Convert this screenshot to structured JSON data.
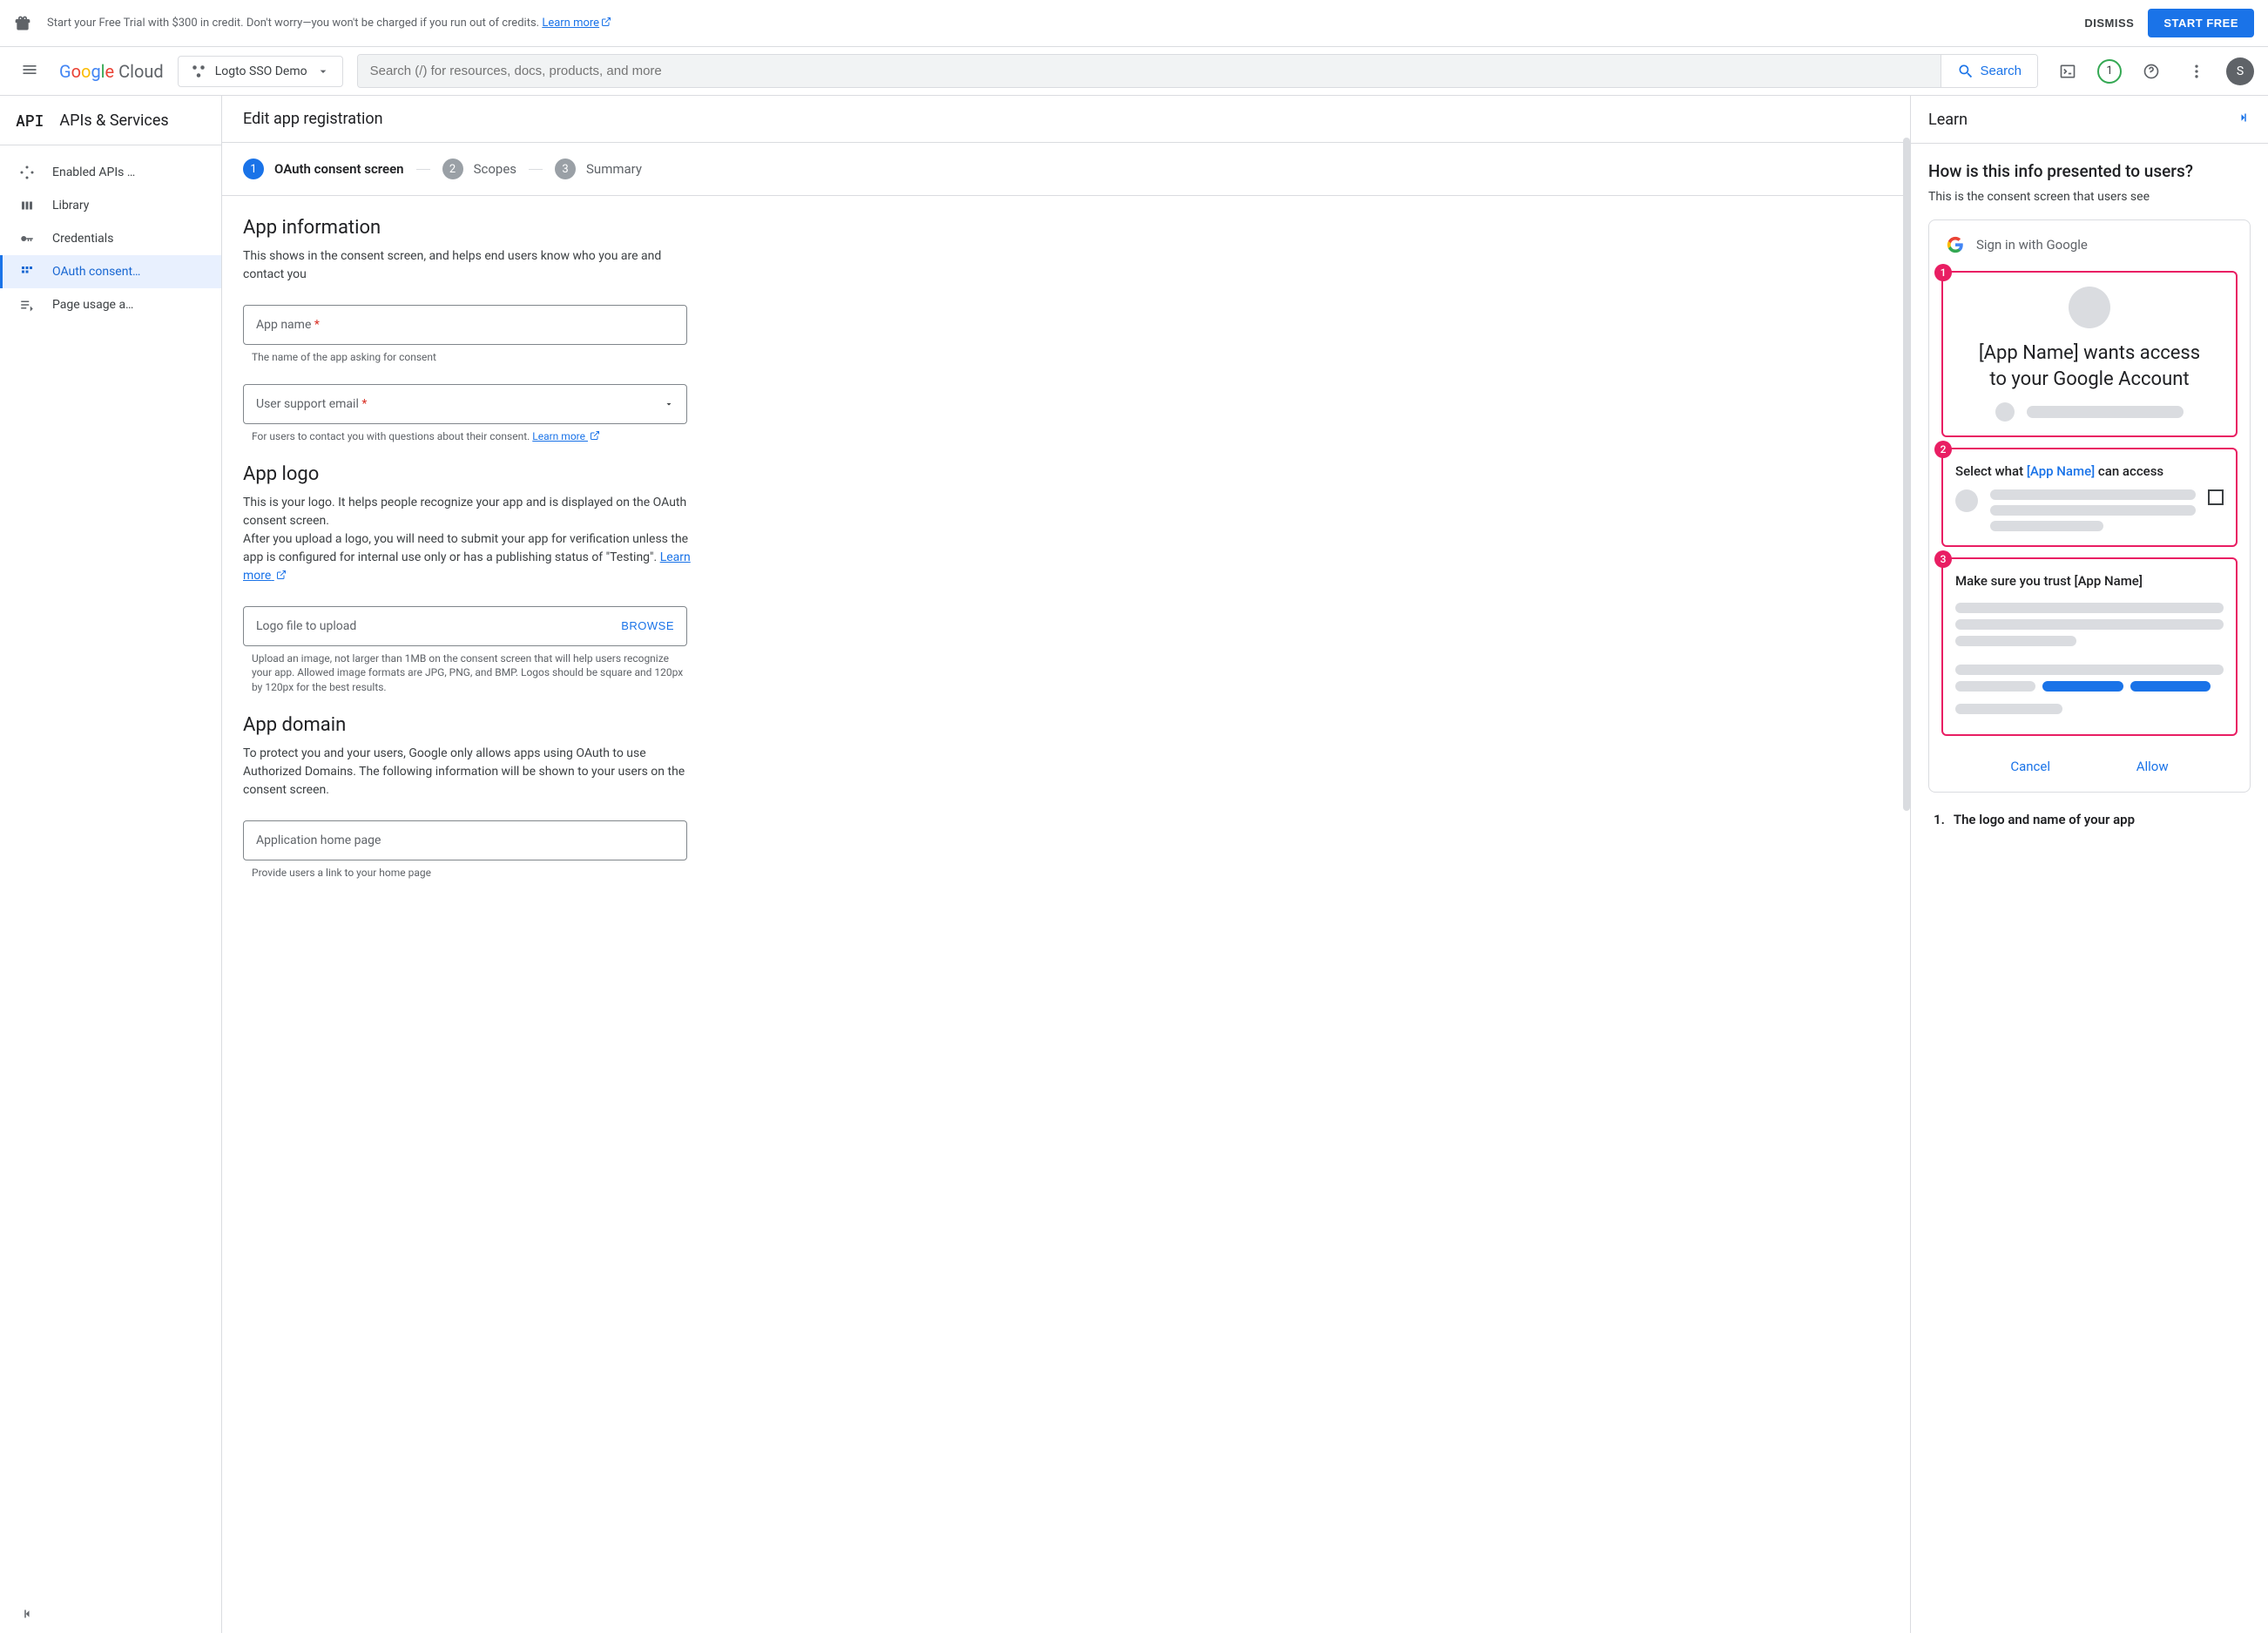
{
  "banner": {
    "text": "Start your Free Trial with $300 in credit. Don't worry—you won't be charged if you run out of credits. ",
    "learn_more": "Learn more",
    "dismiss": "DISMISS",
    "start_free": "START FREE"
  },
  "header": {
    "project_name": "Logto SSO Demo",
    "search_placeholder": "Search (/) for resources, docs, products, and more",
    "search_btn": "Search",
    "badge": "1",
    "avatar": "S"
  },
  "sidebar": {
    "title": "APIs & Services",
    "api_label": "API",
    "items": [
      {
        "label": "Enabled APIs …"
      },
      {
        "label": "Library"
      },
      {
        "label": "Credentials"
      },
      {
        "label": "OAuth consent…"
      },
      {
        "label": "Page usage a…"
      }
    ]
  },
  "content": {
    "title": "Edit app registration",
    "steps": [
      {
        "num": "1",
        "label": "OAuth consent screen"
      },
      {
        "num": "2",
        "label": "Scopes"
      },
      {
        "num": "3",
        "label": "Summary"
      }
    ],
    "app_info": {
      "heading": "App information",
      "desc": "This shows in the consent screen, and helps end users know who you are and contact you",
      "app_name_label": "App name ",
      "app_name_help": "The name of the app asking for consent",
      "email_label": "User support email ",
      "email_help": "For users to contact you with questions about their consent. ",
      "email_learn": "Learn more"
    },
    "app_logo": {
      "heading": "App logo",
      "desc1": "This is your logo. It helps people recognize your app and is displayed on the OAuth consent screen.",
      "desc2": "After you upload a logo, you will need to submit your app for verification unless the app is configured for internal use only or has a publishing status of \"Testing\". ",
      "learn": "Learn more",
      "upload_label": "Logo file to upload",
      "browse": "BROWSE",
      "upload_help": "Upload an image, not larger than 1MB on the consent screen that will help users recognize your app. Allowed image formats are JPG, PNG, and BMP. Logos should be square and 120px by 120px for the best results."
    },
    "app_domain": {
      "heading": "App domain",
      "desc": "To protect you and your users, Google only allows apps using OAuth to use Authorized Domains. The following information will be shown to your users on the consent screen.",
      "home_label": "Application home page",
      "home_help": "Provide users a link to your home page"
    }
  },
  "learn": {
    "title": "Learn",
    "heading": "How is this info presented to users?",
    "sub": "This is the consent screen that users see",
    "signin": "Sign in with Google",
    "box1_text": "[App Name] wants access to your Google Account",
    "box2_prefix": "Select what ",
    "box2_app": "[App Name]",
    "box2_suffix": " can access",
    "box3_text": "Make sure you trust [App Name]",
    "cancel": "Cancel",
    "allow": "Allow",
    "list1_num": "1.",
    "list1": "The logo and name of your app"
  }
}
